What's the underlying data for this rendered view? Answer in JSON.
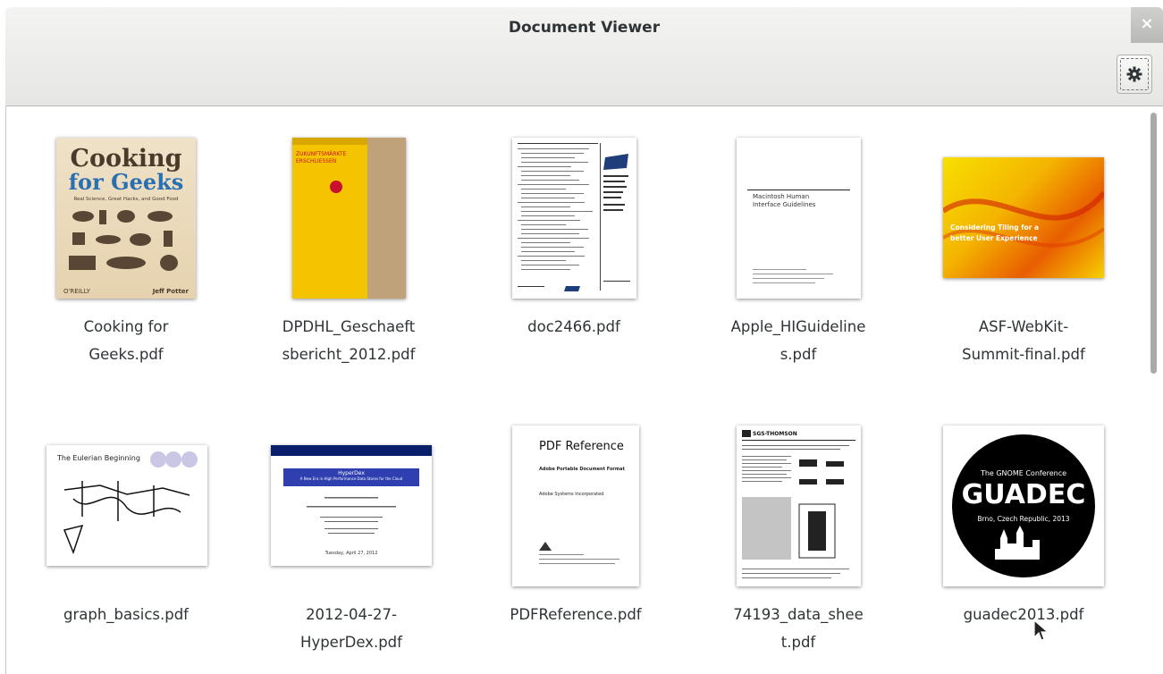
{
  "window": {
    "title": "Document Viewer",
    "close_label": "×"
  },
  "documents": [
    {
      "line1": "Cooking for",
      "line2": "Geeks.pdf",
      "cover": {
        "title1": "Cooking",
        "title2": "for Geeks",
        "subtitle": "Real Science, Great Hacks, and Good Food",
        "publisher": "O'REILLY",
        "author": "Jeff Potter"
      }
    },
    {
      "line1": "DPDHL_Geschaeft",
      "line2": "sbericht_2012.pdf",
      "cover": {
        "title1": "ZUKUNFTSMÄRKTE",
        "title2": "ERSCHLIESSEN"
      }
    },
    {
      "line1": "doc2466.pdf",
      "line2": "",
      "cover": {}
    },
    {
      "line1": "Apple_HIGuideline",
      "line2": "s.pdf",
      "cover": {
        "title1": "Macintosh Human",
        "title2": "Interface Guidelines"
      }
    },
    {
      "line1": "ASF-WebKit-",
      "line2": "Summit-final.pdf",
      "cover": {
        "title1": "Considering Tiling for a",
        "title2": "better User Experience"
      }
    },
    {
      "line1": "graph_basics.pdf",
      "line2": "",
      "cover": {
        "title1": "The Eulerian Beginning"
      }
    },
    {
      "line1": "2012-04-27-",
      "line2": "HyperDex.pdf",
      "cover": {
        "title1": "HyperDex",
        "title2": "A New Era in High Performance Data Stores for the Cloud",
        "footer": "Tuesday, April 27, 2012"
      }
    },
    {
      "line1": "PDFReference.pdf",
      "line2": "",
      "cover": {
        "title1": "PDF Reference",
        "title2": "Adobe Portable Document Format",
        "footer": "Adobe Systems Incorporated"
      }
    },
    {
      "line1": "74193_data_shee",
      "line2": "t.pdf",
      "cover": {
        "title1": "SGS-THOMSON"
      }
    },
    {
      "line1": "guadec2013.pdf",
      "line2": "",
      "cover": {
        "title1": "The GNOME Conference",
        "title2": "GUADEC",
        "subtitle": "Brno, Czech Republic, 2013"
      }
    }
  ]
}
